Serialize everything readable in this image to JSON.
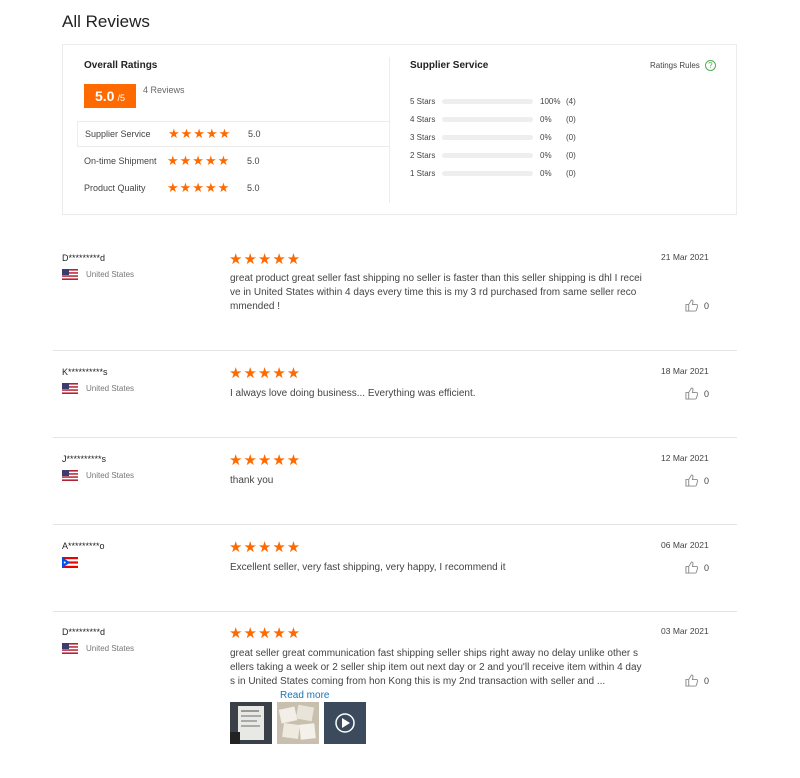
{
  "page": {
    "title": "All Reviews"
  },
  "summary": {
    "overall_title": "Overall Ratings",
    "score": "5.0",
    "score_max": "/5",
    "review_count": "4 Reviews",
    "categories": [
      {
        "label": "Supplier Service",
        "stars": "★★★★★",
        "value": "5.0"
      },
      {
        "label": "On-time Shipment",
        "stars": "★★★★★",
        "value": "5.0"
      },
      {
        "label": "Product Quality",
        "stars": "★★★★★",
        "value": "5.0"
      }
    ],
    "supplier_title": "Supplier Service",
    "rules_label": "Ratings Rules",
    "rules_icon": "help-circle-icon",
    "distribution": [
      {
        "label": "5 Stars",
        "fraction": 1.0,
        "pct": "100%",
        "count": "(4)"
      },
      {
        "label": "4 Stars",
        "fraction": 0.0,
        "pct": "0%",
        "count": "(0)"
      },
      {
        "label": "3 Stars",
        "fraction": 0.0,
        "pct": "0%",
        "count": "(0)"
      },
      {
        "label": "2 Stars",
        "fraction": 0.0,
        "pct": "0%",
        "count": "(0)"
      },
      {
        "label": "1 Stars",
        "fraction": 0.0,
        "pct": "0%",
        "count": "(0)"
      }
    ],
    "accent": "#ff6a00"
  },
  "reviews": [
    {
      "name": "D*********d",
      "country": "United States",
      "flag": "us-flag-icon",
      "stars": "★★★★★",
      "date": "21 Mar 2021",
      "text": "great product great seller fast shipping no seller is faster than this seller shipping is dhl I receive in United States within 4 days every time this is my 3 rd  purchased from same seller recommended !",
      "likes": "0"
    },
    {
      "name": "K**********s",
      "country": "United States",
      "flag": "us-flag-icon",
      "stars": "★★★★★",
      "date": "18 Mar 2021",
      "text": "I always love doing business... Everything was efficient.",
      "likes": "0"
    },
    {
      "name": "J**********s",
      "country": "United States",
      "flag": "us-flag-icon",
      "stars": "★★★★★",
      "date": "12 Mar 2021",
      "text": "thank you",
      "likes": "0"
    },
    {
      "name": "A*********o",
      "country": "",
      "flag": "puerto-rico-flag-icon",
      "stars": "★★★★★",
      "date": "06 Mar 2021",
      "text": "Excellent seller, very fast shipping, very happy, I recommend it",
      "likes": "0"
    },
    {
      "name": "D*********d",
      "country": "United States",
      "flag": "us-flag-icon",
      "stars": "★★★★★",
      "date": "03 Mar 2021",
      "text": "great seller great communication fast shipping seller ships right away no delay unlike other sellers taking a week or 2 seller ship item out next day or 2 and you'll receive item within 4 days in United States coming from hon Kong this is my 2nd transaction with seller and ...",
      "read_more": "Read more",
      "likes": "0"
    }
  ]
}
